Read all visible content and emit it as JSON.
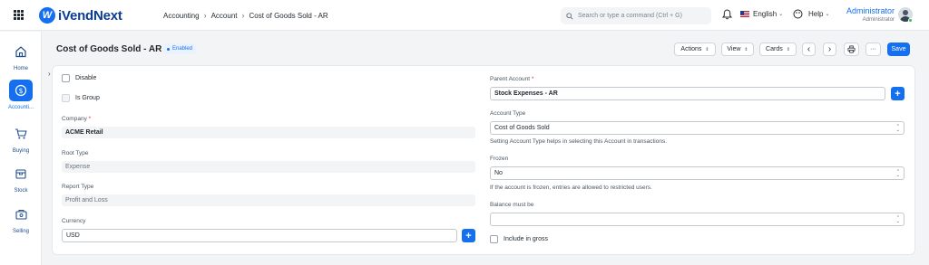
{
  "app": {
    "name": "iVendNext",
    "logo_mark": "W"
  },
  "breadcrumb": [
    "Accounting",
    "Account",
    "Cost of Goods Sold - AR"
  ],
  "search": {
    "placeholder": "Search or type a command (Ctrl + G)"
  },
  "header": {
    "language": "English",
    "help": "Help",
    "user_name": "Administrator",
    "user_role": "Administrator"
  },
  "sidebar": {
    "items": [
      {
        "label": "Home",
        "icon": "home-icon"
      },
      {
        "label": "Accounti...",
        "icon": "dollar-circle-icon",
        "active": true
      },
      {
        "label": "Buying",
        "icon": "cart-icon"
      },
      {
        "label": "Stock",
        "icon": "box-icon"
      },
      {
        "label": "Selling",
        "icon": "store-icon"
      }
    ]
  },
  "page": {
    "title": "Cost of Goods Sold - AR",
    "status": "Enabled"
  },
  "toolbar": {
    "actions": "Actions",
    "view": "View",
    "cards": "Cards",
    "prev": "‹",
    "next": "›",
    "more": "···",
    "save": "Save"
  },
  "form": {
    "disable_label": "Disable",
    "is_group_label": "Is Group",
    "company": {
      "label": "Company",
      "value": "ACME Retail"
    },
    "root_type": {
      "label": "Root Type",
      "value": "Expense"
    },
    "report_type": {
      "label": "Report Type",
      "value": "Profit and Loss"
    },
    "currency": {
      "label": "Currency",
      "value": "USD"
    },
    "parent_account": {
      "label": "Parent Account",
      "value": "Stock Expenses - AR"
    },
    "account_type": {
      "label": "Account Type",
      "value": "Cost of Goods Sold",
      "help": "Setting Account Type helps in selecting this Account in transactions."
    },
    "frozen": {
      "label": "Frozen",
      "value": "No",
      "help": "If the account is frozen, entries are allowed to restricted users."
    },
    "balance_must_be": {
      "label": "Balance must be",
      "value": ""
    },
    "include_in_gross_label": "Include in gross"
  },
  "colors": {
    "primary": "#1570ef",
    "required": "#e11d48"
  }
}
